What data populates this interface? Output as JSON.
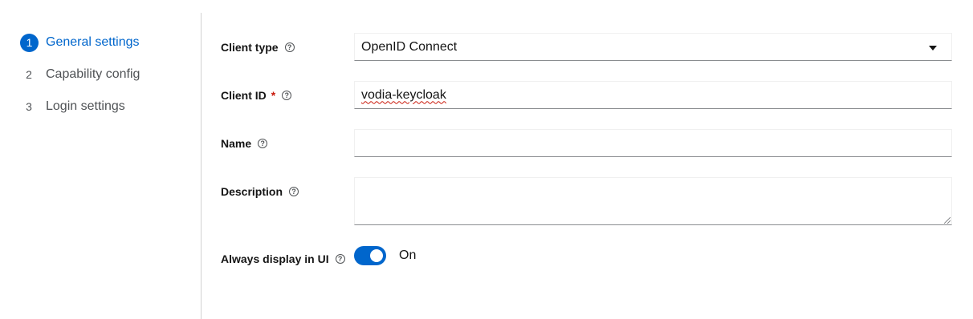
{
  "wizard": {
    "steps": [
      {
        "number": "1",
        "label": "General settings",
        "active": true
      },
      {
        "number": "2",
        "label": "Capability config",
        "active": false
      },
      {
        "number": "3",
        "label": "Login settings",
        "active": false
      }
    ]
  },
  "form": {
    "client_type": {
      "label": "Client type",
      "value": "OpenID Connect"
    },
    "client_id": {
      "label": "Client ID",
      "required_mark": "*",
      "value": "vodia-keycloak"
    },
    "name": {
      "label": "Name",
      "value": ""
    },
    "description": {
      "label": "Description",
      "value": ""
    },
    "always_display": {
      "label": "Always display in UI",
      "state_label": "On",
      "checked": true
    }
  },
  "icons": {
    "help": "question-circle-icon",
    "dropdown": "caret-down-icon"
  },
  "colors": {
    "accent": "#0066cc",
    "required": "#c9190b"
  }
}
